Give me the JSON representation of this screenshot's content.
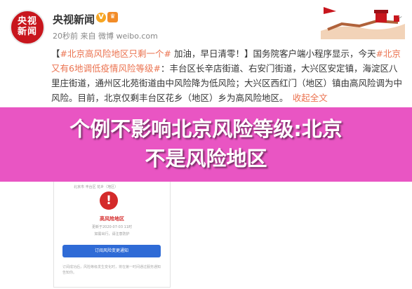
{
  "header": {
    "avatar_line1": "央视",
    "avatar_line2": "新闻",
    "account_name": "央视新闻",
    "meta": "20秒前 来自 微博 weibo.com"
  },
  "post": {
    "bracket_open": "【",
    "topic1": "#北京高风险地区只剩一个#",
    "part1": " 加油，早日清零！】国务院客户端小程序显示，今天",
    "topic2": "#北京又有6地调低疫情风险等级#",
    "part2": "：丰台区长辛店街道、右安门街道，大兴区安定镇，海淀区八里庄街道，通州区北苑街道由中风险降为低风险；大兴区西红门（地区）镇由高风险调为中风险。目前，北京仅剩丰台区花乡（地区）乡为高风险地区。",
    "more_link": "收起全文"
  },
  "overlay": {
    "line1": "个例不影响北京风险等级:北京",
    "line2": "不是风险地区"
  },
  "phone": {
    "top_text": "北京市 丰台区 花乡（地区）",
    "alert_symbol": "!",
    "level_title": "高风险地区",
    "date": "更新于2020-07-03 11时",
    "tip": "如需出行，请注意防护",
    "button_label": "订阅风险变更通知",
    "footer": "订阅成功后，风险等级发生变化时，将在第一时间通过服务通知告知你。"
  },
  "colors": {
    "overlay": "#e746be",
    "link": "#eb7350",
    "alert_red": "#d42a2a",
    "button_blue": "#2f6bd6"
  }
}
